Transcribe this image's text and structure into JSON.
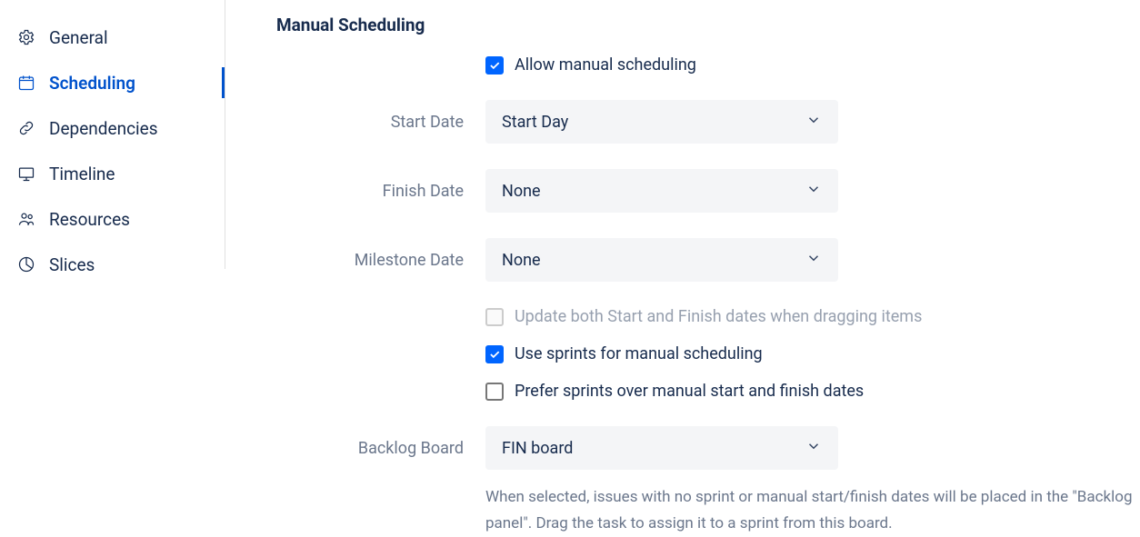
{
  "sidebar": {
    "items": [
      {
        "label": "General",
        "active": false
      },
      {
        "label": "Scheduling",
        "active": true
      },
      {
        "label": "Dependencies",
        "active": false
      },
      {
        "label": "Timeline",
        "active": false
      },
      {
        "label": "Resources",
        "active": false
      },
      {
        "label": "Slices",
        "active": false
      }
    ]
  },
  "section_title": "Manual Scheduling",
  "fields": {
    "allow_manual_label": "Allow manual scheduling",
    "start_date_label": "Start Date",
    "start_date_value": "Start Day",
    "finish_date_label": "Finish Date",
    "finish_date_value": "None",
    "milestone_date_label": "Milestone Date",
    "milestone_date_value": "None",
    "update_both_label": "Update both Start and Finish dates when dragging items",
    "use_sprints_label": "Use sprints for manual scheduling",
    "prefer_sprints_label": "Prefer sprints over manual start and finish dates",
    "backlog_board_label": "Backlog Board",
    "backlog_board_value": "FIN board",
    "backlog_help": "When selected, issues with no sprint or manual start/finish dates will be placed in the \"Backlog panel\". Drag the task to assign it to a sprint from this board."
  }
}
